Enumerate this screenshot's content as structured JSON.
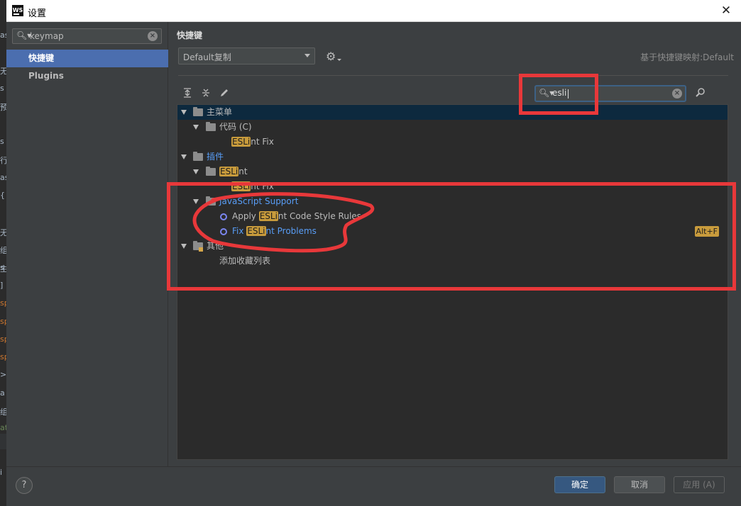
{
  "window": {
    "title": "设置",
    "app_logo": "WS",
    "close_glyph": "✕"
  },
  "sidebar": {
    "search": {
      "value": "keymap",
      "icon": "search-icon"
    },
    "items": [
      {
        "label": "快捷键",
        "active": true
      },
      {
        "label": "Plugins",
        "active": false
      }
    ]
  },
  "main": {
    "section_title": "快捷键",
    "keymap_select": {
      "value": "Default复制",
      "icon": "chevron-down-icon"
    },
    "based_on": "基于快捷键映射:Default",
    "toolbar": {
      "expand_all": "expand-all-icon",
      "collapse_all": "collapse-all-icon",
      "edit": "pencil-icon"
    },
    "filter": {
      "value": "esli"
    },
    "tree": [
      {
        "label": "主菜单",
        "level": 0,
        "expanded": true,
        "selected": true
      },
      {
        "label": "代码 (C)",
        "level": 1,
        "expanded": true
      },
      {
        "pre": "",
        "hl": "ESLi",
        "post": "nt Fix",
        "level": 2
      },
      {
        "label": "插件",
        "level": 0,
        "expanded": true,
        "link": true
      },
      {
        "pre": "",
        "hl": "ESLi",
        "post": "nt",
        "level": 1,
        "expanded": true
      },
      {
        "pre": "",
        "hl": "ESLi",
        "post": "nt Fix",
        "level": 2
      },
      {
        "label": "JavaScript Support",
        "level": 1,
        "expanded": true,
        "link": true
      },
      {
        "pre": "Apply ",
        "hl": "ESLi",
        "post": "nt Code Style Rules",
        "level": 2
      },
      {
        "pre": "Fix ",
        "hl": "ESLi",
        "post": "nt Problems",
        "level": 2,
        "link": true,
        "shortcut": "Alt+F"
      },
      {
        "label": "其他",
        "level": 0,
        "expanded": true
      },
      {
        "label": "添加收藏列表",
        "level": 2
      }
    ]
  },
  "footer": {
    "help_label": "?",
    "ok_label": "确定",
    "cancel_label": "取消",
    "apply_label": "应用 (A)"
  },
  "background_editor": {
    "fragments": [
      "as",
      "无",
      "s",
      "预",
      "s",
      "行",
      "as",
      "{",
      "无",
      "组",
      "s",
      "主",
      "]",
      "sp",
      "sp",
      "sp",
      "sp",
      ">",
      "a",
      "组",
      "at",
      "i"
    ]
  }
}
